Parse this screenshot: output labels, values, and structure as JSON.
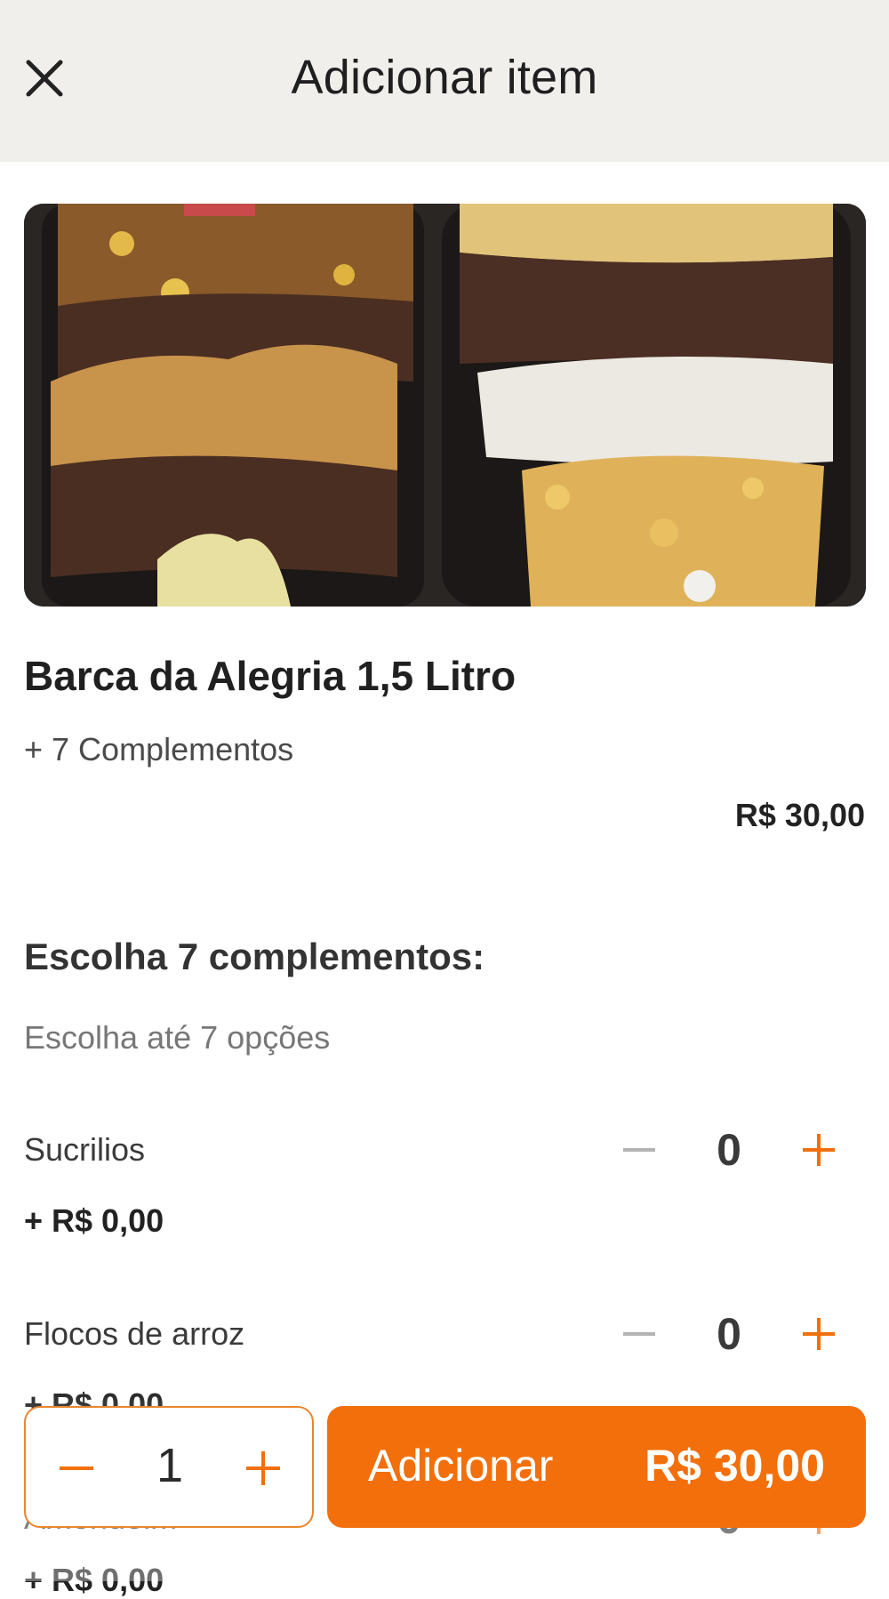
{
  "header": {
    "title": "Adicionar item",
    "close_icon": "close-icon"
  },
  "product": {
    "name": "Barca da Alegria 1,5 Litro",
    "subtitle": "+ 7 Complementos",
    "price": "R$ 30,00"
  },
  "complements": {
    "title": "Escolha 7 complementos:",
    "subtitle": "Escolha até 7 opções",
    "options": [
      {
        "name": "Sucrilios",
        "price": "+ R$ 0,00",
        "count": "0"
      },
      {
        "name": "Flocos de arroz",
        "price": "+ R$ 0,00",
        "count": "0"
      },
      {
        "name": "Amendoim",
        "price": "+ R$ 0,00",
        "count": "0"
      }
    ]
  },
  "footer": {
    "quantity": "1",
    "add_label": "Adicionar",
    "add_price": "R$ 30,00"
  },
  "colors": {
    "accent": "#f26f0b",
    "header_bg": "#f1efeb",
    "minus_disabled": "#b3b3b3"
  }
}
